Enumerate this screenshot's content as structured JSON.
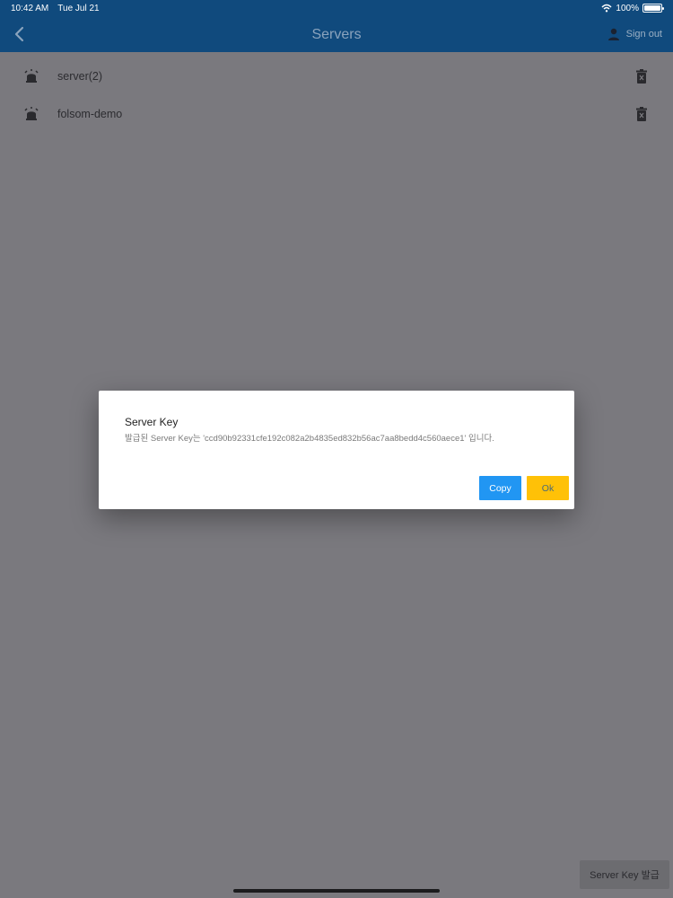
{
  "status_bar": {
    "time": "10:42 AM",
    "date": "Tue Jul 21",
    "battery": "100%"
  },
  "app_bar": {
    "title": "Servers",
    "sign_out_label": "Sign out"
  },
  "servers": [
    {
      "name": "server(2)"
    },
    {
      "name": "folsom-demo"
    }
  ],
  "bottom_button": {
    "label": "Server Key 발급"
  },
  "dialog": {
    "title": "Server Key",
    "message": "발급된 Server Key는 'ccd90b92331cfe192c082a2b4835ed832b56ac7aa8bedd4c560aece1' 입니다.",
    "copy_label": "Copy",
    "ok_label": "Ok"
  },
  "colors": {
    "app_bar": "#104a7d",
    "overlay_background": "#7a797e",
    "copy_button": "#2196f3",
    "ok_button": "#ffc107"
  },
  "icons": {
    "back": "chevron-left-icon",
    "sign_out": "person-icon",
    "server": "alarm-icon",
    "delete": "trash-icon",
    "wifi": "wifi-icon",
    "battery": "battery-icon"
  }
}
